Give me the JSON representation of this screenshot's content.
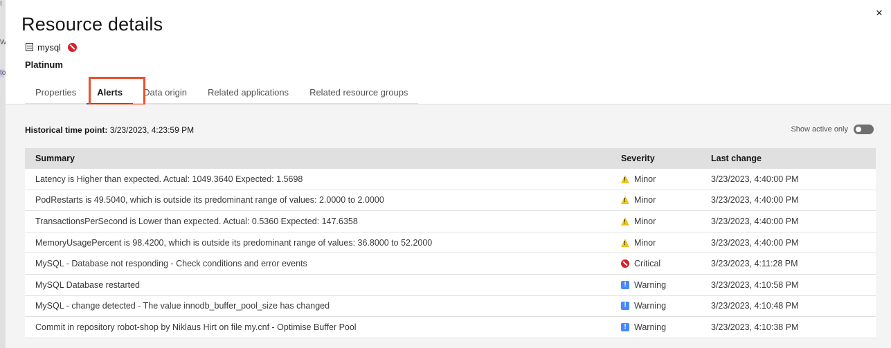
{
  "backdrop": {
    "fragments": [
      "I",
      "W",
      "to"
    ]
  },
  "header": {
    "title": "Resource details",
    "resource_name": "mysql",
    "tier": "Platinum",
    "close_glyph": "×"
  },
  "tabs": [
    {
      "label": "Properties",
      "active": false
    },
    {
      "label": "Alerts",
      "active": true
    },
    {
      "label": "Data origin",
      "active": false
    },
    {
      "label": "Related applications",
      "active": false
    },
    {
      "label": "Related resource groups",
      "active": false
    }
  ],
  "alerts": {
    "historical_label": "Historical time point:",
    "historical_value": "3/23/2023, 4:23:59 PM",
    "show_active_only_label": "Show active only",
    "show_active_only": false,
    "columns": {
      "summary": "Summary",
      "severity": "Severity",
      "last_change": "Last change"
    },
    "rows": [
      {
        "summary": "Latency is Higher than expected. Actual: 1049.3640 Expected: 1.5698",
        "severity": "Minor",
        "icon": "warning-triangle-icon",
        "last_change": "3/23/2023, 4:40:00 PM"
      },
      {
        "summary": "PodRestarts is 49.5040, which is outside its predominant range of values: 2.0000 to 2.0000",
        "severity": "Minor",
        "icon": "warning-triangle-icon",
        "last_change": "3/23/2023, 4:40:00 PM"
      },
      {
        "summary": "TransactionsPerSecond is Lower than expected. Actual: 0.5360 Expected: 147.6358",
        "severity": "Minor",
        "icon": "warning-triangle-icon",
        "last_change": "3/23/2023, 4:40:00 PM"
      },
      {
        "summary": "MemoryUsagePercent is 98.4200, which is outside its predominant range of values: 36.8000 to 52.2000",
        "severity": "Minor",
        "icon": "warning-triangle-icon",
        "last_change": "3/23/2023, 4:40:00 PM"
      },
      {
        "summary": "MySQL - Database not responding - Check conditions and error events",
        "severity": "Critical",
        "icon": "critical-icon",
        "last_change": "3/23/2023, 4:11:28 PM"
      },
      {
        "summary": "MySQL Database restarted",
        "severity": "Warning",
        "icon": "info-square-icon",
        "last_change": "3/23/2023, 4:10:58 PM"
      },
      {
        "summary": "MySQL - change detected - The value innodb_buffer_pool_size has changed",
        "severity": "Warning",
        "icon": "info-square-icon",
        "last_change": "3/23/2023, 4:10:48 PM"
      },
      {
        "summary": "Commit in repository robot-shop by Niklaus Hirt on file my.cnf - Optimise Buffer Pool",
        "severity": "Warning",
        "icon": "info-square-icon",
        "last_change": "3/23/2023, 4:10:38 PM"
      }
    ]
  },
  "colors": {
    "critical": "#da1e28",
    "minor": "#f1c21b",
    "warning": "#4589ff",
    "highlight_box": "#e8502c"
  }
}
